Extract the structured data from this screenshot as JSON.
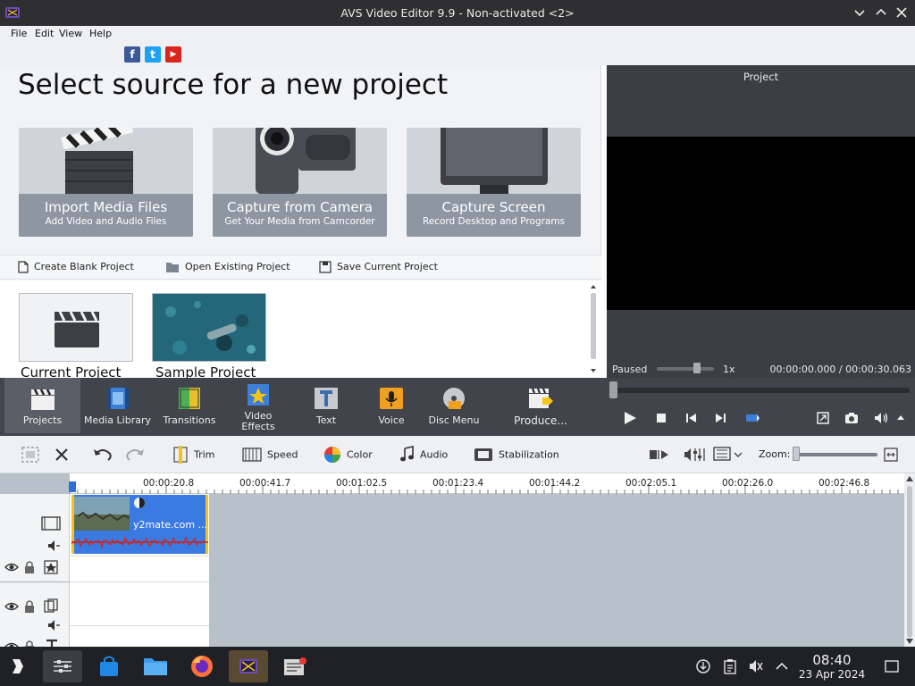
{
  "window": {
    "title": "AVS Video Editor 9.9 - Non-activated <2>"
  },
  "menu": {
    "items": [
      "File",
      "Edit",
      "View",
      "Help"
    ]
  },
  "social": {
    "facebook": "f",
    "twitter": "t",
    "youtube": "▶"
  },
  "start": {
    "heading": "Select source for a new project",
    "cards": [
      {
        "title": "Import Media Files",
        "subtitle": "Add Video and Audio Files",
        "icon": "clapperboard-icon"
      },
      {
        "title": "Capture from Camera",
        "subtitle": "Get Your Media from Camcorder",
        "icon": "camcorder-icon"
      },
      {
        "title": "Capture Screen",
        "subtitle": "Record Desktop and Programs",
        "icon": "monitor-icon"
      }
    ],
    "quick": {
      "blank": "Create Blank Project",
      "open": "Open Existing Project",
      "save": "Save Current Project"
    },
    "recent": {
      "current": "Current Project",
      "sample": "Sample Project"
    }
  },
  "preview": {
    "title": "Project",
    "status": "Paused",
    "speed": "1x",
    "time": "00:00:00.000 /  00:00:30.063"
  },
  "toolbar": {
    "projects": "Projects",
    "media_library": "Media Library",
    "transitions": "Transitions",
    "video_effects": "Video\nEffects",
    "text": "Text",
    "voice": "Voice",
    "disc_menu": "Disc Menu",
    "produce": "Produce..."
  },
  "edit": {
    "trim": "Trim",
    "speed": "Speed",
    "color": "Color",
    "audio": "Audio",
    "stabilization": "Stabilization",
    "zoom": "Zoom:"
  },
  "timeline": {
    "ruler": [
      "00:00:20.8",
      "00:00:41.7",
      "00:01:02.5",
      "00:01:23.4",
      "00:01:44.2",
      "00:02:05.1",
      "00:02:26.0",
      "00:02:46.8"
    ],
    "clip_name": "y2mate.com ..."
  },
  "taskbar": {
    "time": "08:40",
    "date": "23 Apr 2024"
  },
  "colors": {
    "titlebar": "#2f2f31",
    "toolbar_dark": "#41444b",
    "clip_blue": "#3b7ae0",
    "clip_border": "#f2c41b",
    "waveform": "#c62828"
  }
}
